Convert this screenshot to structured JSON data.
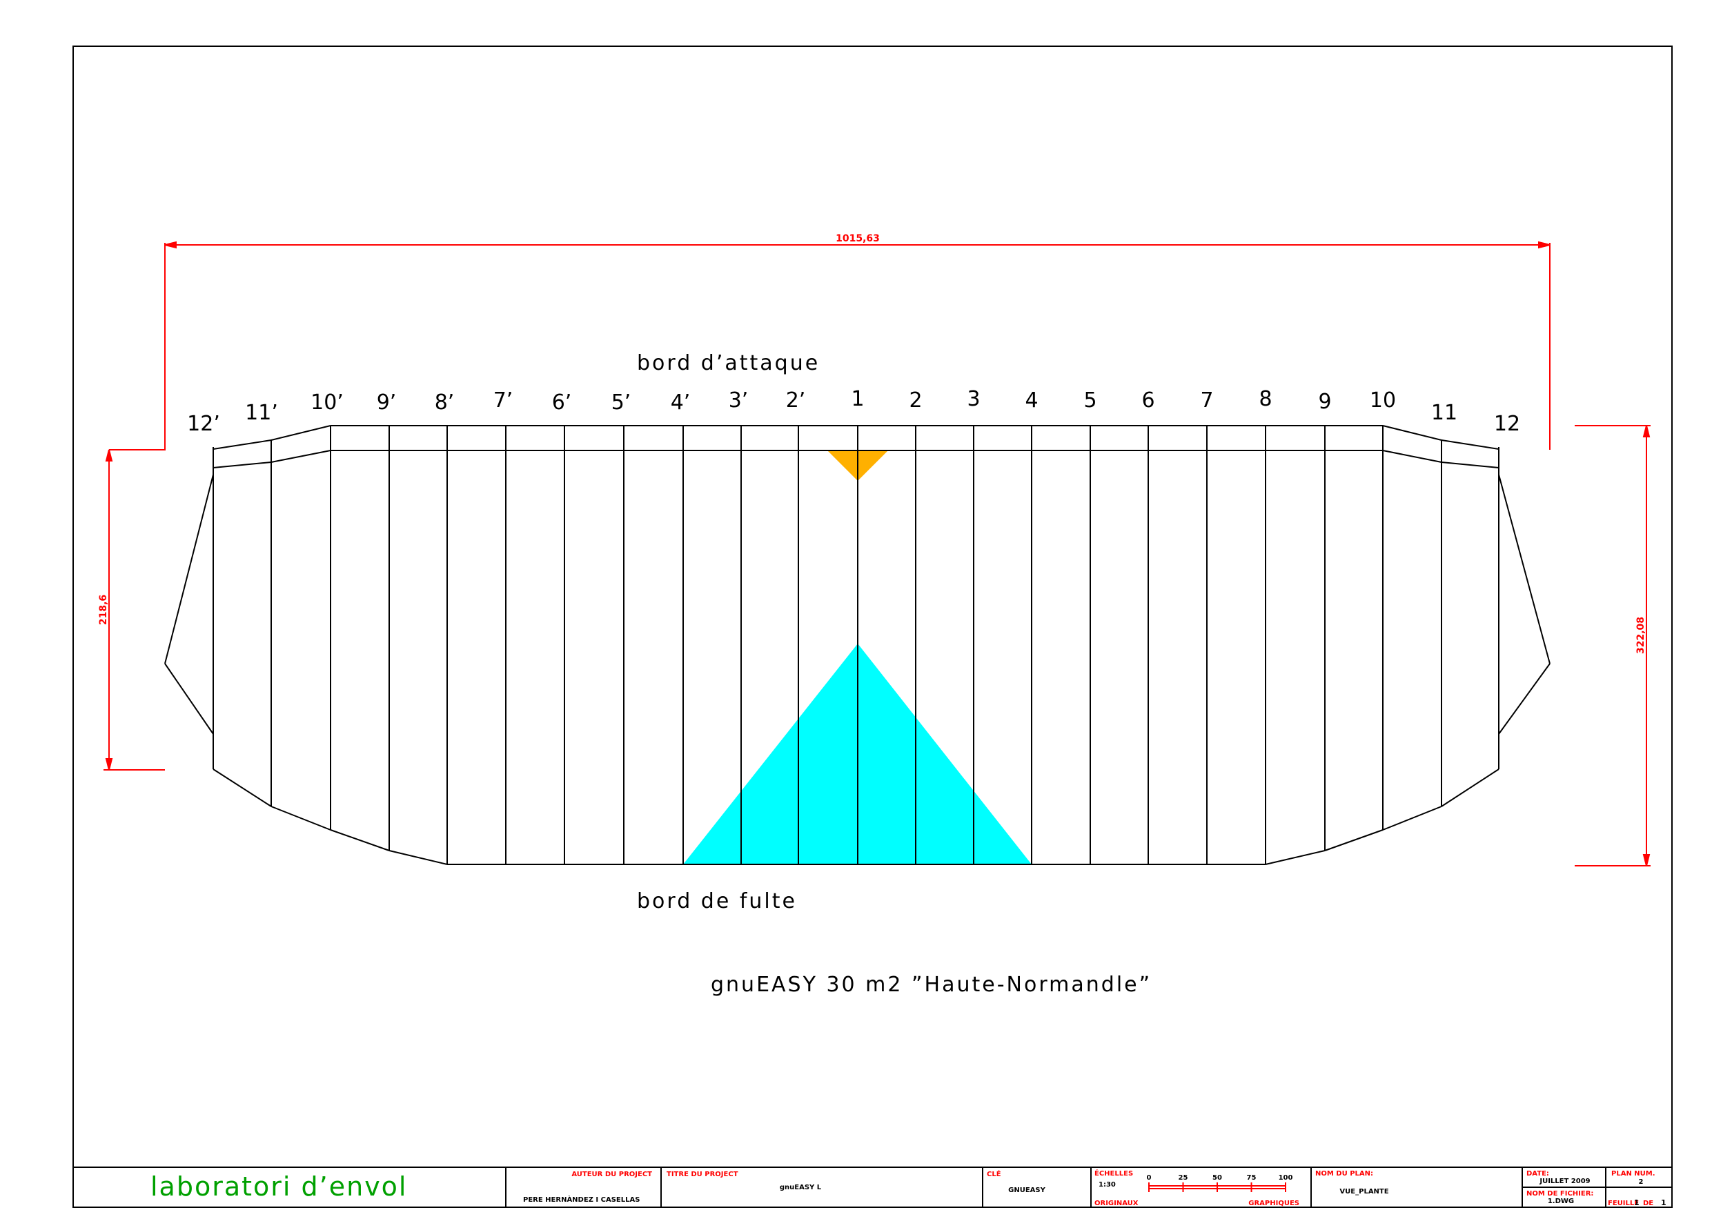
{
  "diagram": {
    "top_label": "bord d’attaque",
    "bottom_label": "bord de fulte",
    "title": "gnuEASY 30 m2 ”Haute-Normandle”",
    "dim_span": "1015,63",
    "dim_left": "218,6",
    "dim_right": "322,08",
    "rib_labels": [
      "12’",
      "11’",
      "10’",
      "9’",
      "8’",
      "7’",
      "6’",
      "5’",
      "4’",
      "3’",
      "2’",
      "1",
      "2",
      "3",
      "4",
      "5",
      "6",
      "7",
      "8",
      "9",
      "10",
      "11",
      "12"
    ],
    "colors": {
      "dimension": "#ff0000",
      "triangle_cyan": "#00ffff",
      "triangle_orange": "#ffb000",
      "logo": "#00a000"
    }
  },
  "title_block": {
    "logo": "laboratori d’envol",
    "author_label": "AUTEUR DU PROJECT",
    "author": "PERE HERNÀNDEZ I CASELLAS",
    "project_title_label": "TITRE DU PROJECT",
    "project_title": "gnuEASY L",
    "key_label": "CLÉ",
    "key": "GNUEASY",
    "scales_label": "ÉCHELLES",
    "scale": "1:30",
    "originals_label": "ORIGINAUX",
    "graphics_label": "GRAPHIQUES",
    "scale_ticks": [
      "0",
      "25",
      "50",
      "75",
      "100"
    ],
    "plan_name_label": "NOM DU PLAN:",
    "plan_name": "VUE_PLANTE",
    "date_label": "DATE:",
    "date": "JUILLET 2009",
    "file_label": "NOM DE FICHIER:",
    "file": "1.DWG",
    "plan_num_label": "PLAN NUM.",
    "plan_num": "2",
    "sheet_label": "FEUILLE",
    "sheet_num": "1",
    "sheet_of": "DE",
    "sheet_total": "1"
  }
}
